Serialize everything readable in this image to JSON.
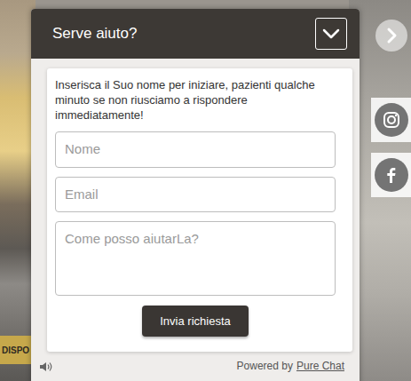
{
  "site": {
    "banner": "DISPO"
  },
  "chat": {
    "title": "Serve aiuto?",
    "expanded": true,
    "intro": "Inserisca il Suo nome per iniziare, pazienti qualche minuto se non riusciamo a rispondere immediatamente!",
    "fields": [
      {
        "placeholder": "Nome",
        "kind": "input"
      },
      {
        "placeholder": "Email",
        "kind": "input"
      },
      {
        "placeholder": "Come posso aiutarLa?",
        "kind": "textarea"
      }
    ],
    "submit": "Invia richiesta",
    "footer": {
      "prefix": "Powered by",
      "link": "Pure Chat"
    }
  }
}
